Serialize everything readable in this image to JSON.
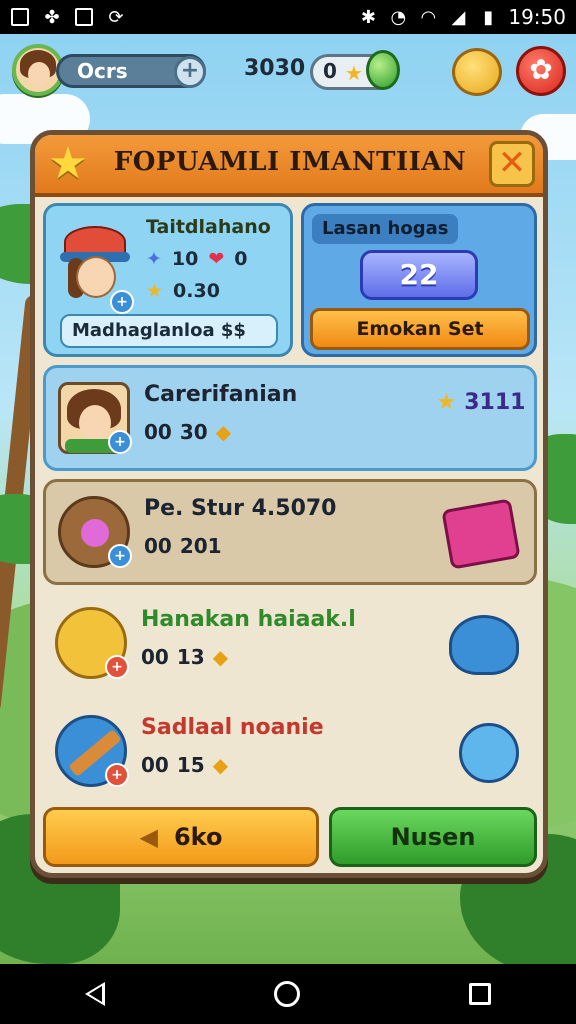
{
  "status_bar": {
    "time": "19:50"
  },
  "hud": {
    "player_name": "Ocrs",
    "add_symbol": "+",
    "coins": "3030",
    "gems": "0",
    "gift_symbol": "✿"
  },
  "panel": {
    "title": "FOPUAMLI IMANTIIAN",
    "close_symbol": "✕",
    "profile": {
      "title": "Taitdlahano",
      "stat1_value": "10",
      "stat1_suffix": "0",
      "stat2_value": "0.30",
      "footer": "Madhaglanloa $$"
    },
    "league": {
      "label": "Lasan hogas",
      "value": "22",
      "button": "Emokan Set"
    },
    "rows": [
      {
        "title": "Carerifanian",
        "count": "00",
        "value": "30",
        "right_value": "3111"
      },
      {
        "title": "Pe. Stur 4.5070",
        "count": "00",
        "value": "201",
        "right_value": ""
      },
      {
        "title": "Hanakan haiaak.l",
        "count": "00",
        "value": "13",
        "right_value": ""
      },
      {
        "title": "Sadlaal noanie",
        "count": "00",
        "value": "15",
        "right_value": ""
      }
    ],
    "buttons": {
      "back_label": "6ko",
      "confirm_label": "Nusen"
    }
  },
  "colors": {
    "header_orange": "#f49a3a",
    "panel_bg": "#efe6d2",
    "blue_row": "#9fd2ee",
    "tan_row": "#d9c9a8",
    "confirm_green": "#2f9c2a",
    "back_orange": "#f39a1a"
  }
}
